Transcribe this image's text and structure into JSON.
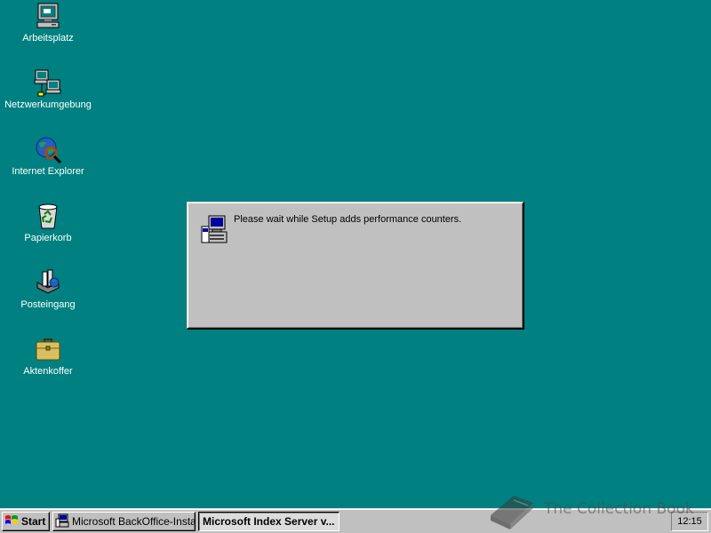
{
  "desktop": {
    "icons": [
      {
        "label": "Arbeitsplatz",
        "icon": "my-computer-icon"
      },
      {
        "label": "Netzwerkumgebung",
        "icon": "network-neighborhood-icon"
      },
      {
        "label": "Internet Explorer",
        "icon": "internet-explorer-icon"
      },
      {
        "label": "Papierkorb",
        "icon": "recycle-bin-icon"
      },
      {
        "label": "Posteingang",
        "icon": "inbox-icon"
      },
      {
        "label": "Aktenkoffer",
        "icon": "briefcase-icon"
      }
    ]
  },
  "dialog": {
    "message": "Please wait while Setup adds performance counters.",
    "icon": "setup-computer-icon"
  },
  "taskbar": {
    "start_label": "Start",
    "tasks": [
      {
        "label": "Microsoft BackOffice-Instal...",
        "icon": "setup-app-icon",
        "active": false
      },
      {
        "label": "Microsoft Index Server v...",
        "active": true
      }
    ],
    "clock": "12:15"
  },
  "watermark": {
    "text": "The Collection Book"
  },
  "colors": {
    "desktop": "#008080",
    "face": "#c0c0c0",
    "label_text": "#ffffff"
  }
}
